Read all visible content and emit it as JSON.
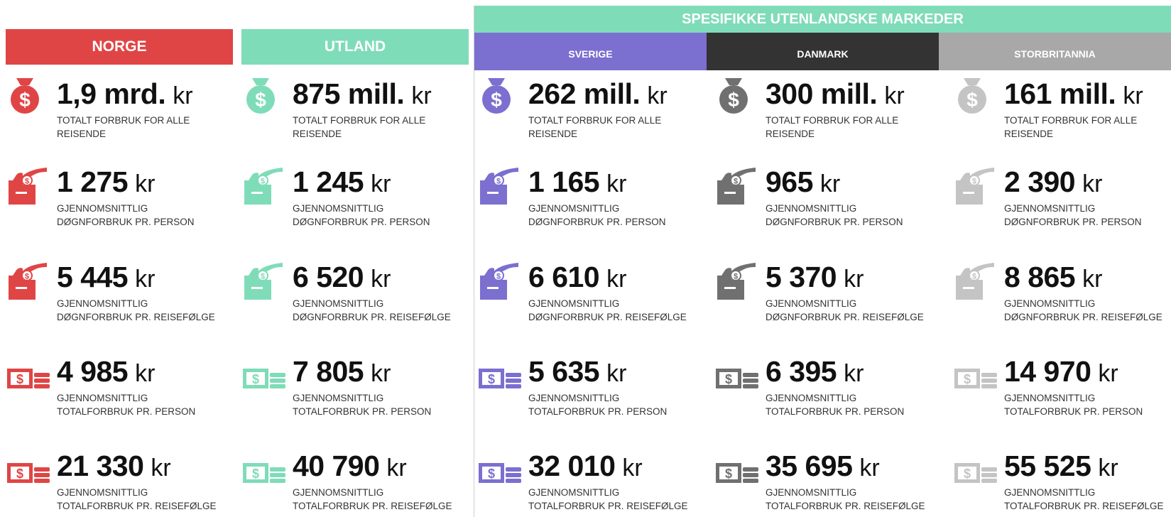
{
  "header": {
    "market_group_title": "SPESIFIKKE UTENLANDSKE MARKEDER"
  },
  "columns": [
    {
      "id": "norge",
      "label": "NORGE",
      "color": "#e04545",
      "metrics": [
        {
          "icon": "money-bag-icon",
          "value": "1,9 mrd.",
          "unit": "kr",
          "line1": "TOTALT FORBRUK FOR ALLE",
          "line2": "REISENDE"
        },
        {
          "icon": "hand-donation-box-icon",
          "value": "1 275",
          "unit": "kr",
          "line1": "GJENNOMSNITTLIG",
          "line2": "DØGNFORBRUK PR. PERSON"
        },
        {
          "icon": "hand-donation-box-icon",
          "value": "5 445",
          "unit": "kr",
          "line1": "GJENNOMSNITTLIG",
          "line2": "DØGNFORBRUK PR. REISEFØLGE"
        },
        {
          "icon": "bill-cash-icon",
          "value": "4 985",
          "unit": "kr",
          "line1": "GJENNOMSNITTLIG",
          "line2": "TOTALFORBRUK PR. PERSON"
        },
        {
          "icon": "bill-cash-icon",
          "value": "21 330",
          "unit": "kr",
          "line1": "GJENNOMSNITTLIG",
          "line2": "TOTALFORBRUK PR. REISEFØLGE"
        }
      ]
    },
    {
      "id": "utland",
      "label": "UTLAND",
      "color": "#7fdcb8",
      "metrics": [
        {
          "icon": "money-bag-icon",
          "value": "875 mill.",
          "unit": "kr",
          "line1": "TOTALT FORBRUK FOR ALLE",
          "line2": "REISENDE"
        },
        {
          "icon": "hand-donation-box-icon",
          "value": "1 245",
          "unit": "kr",
          "line1": "GJENNOMSNITTLIG",
          "line2": "DØGNFORBRUK PR. PERSON"
        },
        {
          "icon": "hand-donation-box-icon",
          "value": "6 520",
          "unit": "kr",
          "line1": "GJENNOMSNITTLIG",
          "line2": "DØGNFORBRUK PR. REISEFØLGE"
        },
        {
          "icon": "bill-cash-icon",
          "value": "7 805",
          "unit": "kr",
          "line1": "GJENNOMSNITTLIG",
          "line2": "TOTALFORBRUK PR. PERSON"
        },
        {
          "icon": "bill-cash-icon",
          "value": "40 790",
          "unit": "kr",
          "line1": "GJENNOMSNITTLIG",
          "line2": "TOTALFORBRUK PR. REISEFØLGE"
        }
      ]
    },
    {
      "id": "sverige",
      "label": "SVERIGE",
      "color": "#7b6fd0",
      "metrics": [
        {
          "icon": "money-bag-icon",
          "value": "262 mill.",
          "unit": "kr",
          "line1": "TOTALT FORBRUK FOR ALLE",
          "line2": "REISENDE"
        },
        {
          "icon": "hand-donation-box-icon",
          "value": "1 165",
          "unit": "kr",
          "line1": "GJENNOMSNITTLIG",
          "line2": "DØGNFORBRUK PR. PERSON"
        },
        {
          "icon": "hand-donation-box-icon",
          "value": "6 610",
          "unit": "kr",
          "line1": "GJENNOMSNITTLIG",
          "line2": "DØGNFORBRUK PR. REISEFØLGE"
        },
        {
          "icon": "bill-cash-icon",
          "value": "5 635",
          "unit": "kr",
          "line1": "GJENNOMSNITTLIG",
          "line2": "TOTALFORBRUK PR. PERSON"
        },
        {
          "icon": "bill-cash-icon",
          "value": "32 010",
          "unit": "kr",
          "line1": "GJENNOMSNITTLIG",
          "line2": "TOTALFORBRUK PR. REISEFØLGE"
        }
      ]
    },
    {
      "id": "danmark",
      "label": "DANMARK",
      "color": "#333333",
      "icon_color": "#707070",
      "metrics": [
        {
          "icon": "money-bag-icon",
          "value": "300 mill.",
          "unit": "kr",
          "line1": "TOTALT FORBRUK FOR ALLE",
          "line2": "REISENDE"
        },
        {
          "icon": "hand-donation-box-icon",
          "value": "965",
          "unit": "kr",
          "line1": "GJENNOMSNITTLIG",
          "line2": "DØGNFORBRUK PR. PERSON"
        },
        {
          "icon": "hand-donation-box-icon",
          "value": "5 370",
          "unit": "kr",
          "line1": "GJENNOMSNITTLIG",
          "line2": "DØGNFORBRUK PR. REISEFØLGE"
        },
        {
          "icon": "bill-cash-icon",
          "value": "6 395",
          "unit": "kr",
          "line1": "GJENNOMSNITTLIG",
          "line2": "TOTALFORBRUK PR. PERSON"
        },
        {
          "icon": "bill-cash-icon",
          "value": "35 695",
          "unit": "kr",
          "line1": "GJENNOMSNITTLIG",
          "line2": "TOTALFORBRUK PR. REISEFØLGE"
        }
      ]
    },
    {
      "id": "storbritannia",
      "label": "STORBRITANNIA",
      "color": "#a8a8a8",
      "icon_color": "#c4c4c4",
      "metrics": [
        {
          "icon": "money-bag-icon",
          "value": "161 mill.",
          "unit": "kr",
          "line1": "TOTALT FORBRUK FOR ALLE",
          "line2": "REISENDE"
        },
        {
          "icon": "hand-donation-box-icon",
          "value": "2 390",
          "unit": "kr",
          "line1": "GJENNOMSNITTLIG",
          "line2": "DØGNFORBRUK PR. PERSON"
        },
        {
          "icon": "hand-donation-box-icon",
          "value": "8 865",
          "unit": "kr",
          "line1": "GJENNOMSNITTLIG",
          "line2": "DØGNFORBRUK PR. REISEFØLGE"
        },
        {
          "icon": "bill-cash-icon",
          "value": "14 970",
          "unit": "kr",
          "line1": "GJENNOMSNITTLIG",
          "line2": "TOTALFORBRUK PR. PERSON"
        },
        {
          "icon": "bill-cash-icon",
          "value": "55 525",
          "unit": "kr",
          "line1": "GJENNOMSNITTLIG",
          "line2": "TOTALFORBRUK PR. REISEFØLGE"
        }
      ]
    }
  ],
  "market_group_color": "#7fdcb8"
}
